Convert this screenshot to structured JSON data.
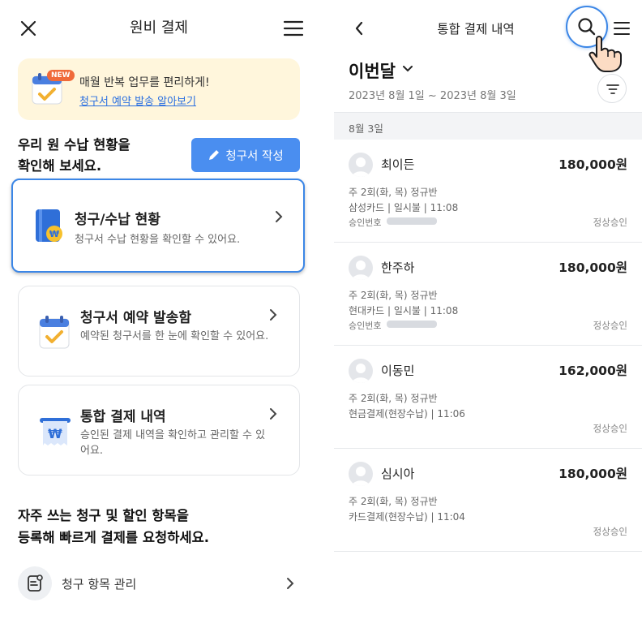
{
  "left": {
    "header": {
      "title": "원비 결제"
    },
    "banner": {
      "badge": "NEW",
      "text": "매월 반복 업무를 편리하게!",
      "link": "청구서 예약 발송 알아보기"
    },
    "section1": {
      "line1": "우리 원 수납 현황을",
      "line2": "확인해 보세요."
    },
    "write_button": "청구서 작성",
    "cards": [
      {
        "title": "청구/수납 현황",
        "desc": "청구서 수납 현황을 확인할 수 있어요."
      },
      {
        "title": "청구서 예약 발송함",
        "desc": "예약된 청구서를 한 눈에 확인할 수 있어요."
      },
      {
        "title": "통합 결제 내역",
        "desc": "승인된 결제 내역을 확인하고 관리할 수 있어요."
      }
    ],
    "section2": {
      "line1": "자주 쓰는 청구 및 할인 항목을",
      "line2": "등록해 빠르게 결제를 요청하세요."
    },
    "item_row": {
      "label": "청구 항목 관리"
    }
  },
  "right": {
    "header": {
      "title": "통합 결제 내역"
    },
    "period": "이번달",
    "date_range": "2023년 8월 1일 ~ 2023년 8월 3일",
    "day_header": "8월 3일",
    "entries": [
      {
        "name": "최이든",
        "amount": "180,000원",
        "line1": "주 2회(화, 목) 정규반",
        "line2": "삼성카드 | 일시불 | 11:08",
        "approval_label": "승인번호",
        "status": "정상승인"
      },
      {
        "name": "한주하",
        "amount": "180,000원",
        "line1": "주 2회(화, 목) 정규반",
        "line2": "현대카드 | 일시불 | 11:08",
        "approval_label": "승인번호",
        "status": "정상승인"
      },
      {
        "name": "이동민",
        "amount": "162,000원",
        "line1": "주 2회(화, 목) 정규반",
        "line2": "현금결제(현장수납) | 11:06",
        "status": "정상승인"
      },
      {
        "name": "심시아",
        "amount": "180,000원",
        "line1": "주 2회(화, 목) 정규반",
        "line2": "카드결제(현장수납) | 11:04",
        "status": "정상승인"
      }
    ]
  },
  "colors": {
    "accent": "#4a8ef0",
    "banner_bg": "#fff6dc",
    "badge": "#f06a3a",
    "link": "#2a6fe0"
  },
  "icons": [
    "close-icon",
    "menu-icon",
    "calendar-check-icon",
    "pencil-icon",
    "book-won-icon",
    "chevron-right-icon",
    "receipt-won-icon",
    "list-manage-icon",
    "back-icon",
    "search-icon",
    "filter-icon",
    "hand-pointer-icon",
    "avatar-icon"
  ]
}
